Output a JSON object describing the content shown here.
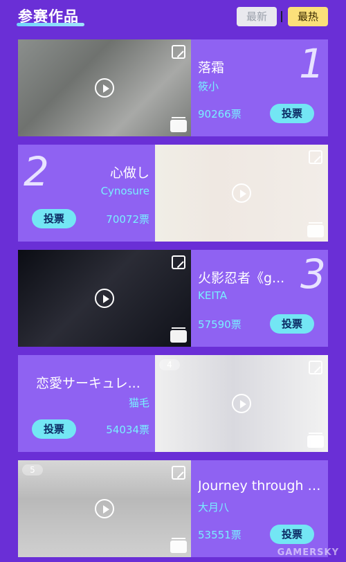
{
  "header": {
    "title": "参赛作品",
    "sort_latest": "最新",
    "sort_hot": "最热"
  },
  "entries": [
    {
      "rank": "1",
      "title": "落霜",
      "author": "筱小",
      "votes": "90266票",
      "vote_label": "投票"
    },
    {
      "rank": "2",
      "title": "心做し",
      "author": "Cynosure",
      "votes": "70072票",
      "vote_label": "投票"
    },
    {
      "rank": "3",
      "title": "火影忍者《g...",
      "author": "KEITA",
      "votes": "57590票",
      "vote_label": "投票"
    },
    {
      "rank": "4",
      "title": "恋愛サーキュレ...",
      "author": "猫毛",
      "votes": "54034票",
      "vote_label": "投票"
    },
    {
      "rank": "5",
      "title": "Journey through t...",
      "author": "大月八",
      "votes": "53551票",
      "vote_label": "投票"
    }
  ],
  "watermark": "GAMERSKY"
}
